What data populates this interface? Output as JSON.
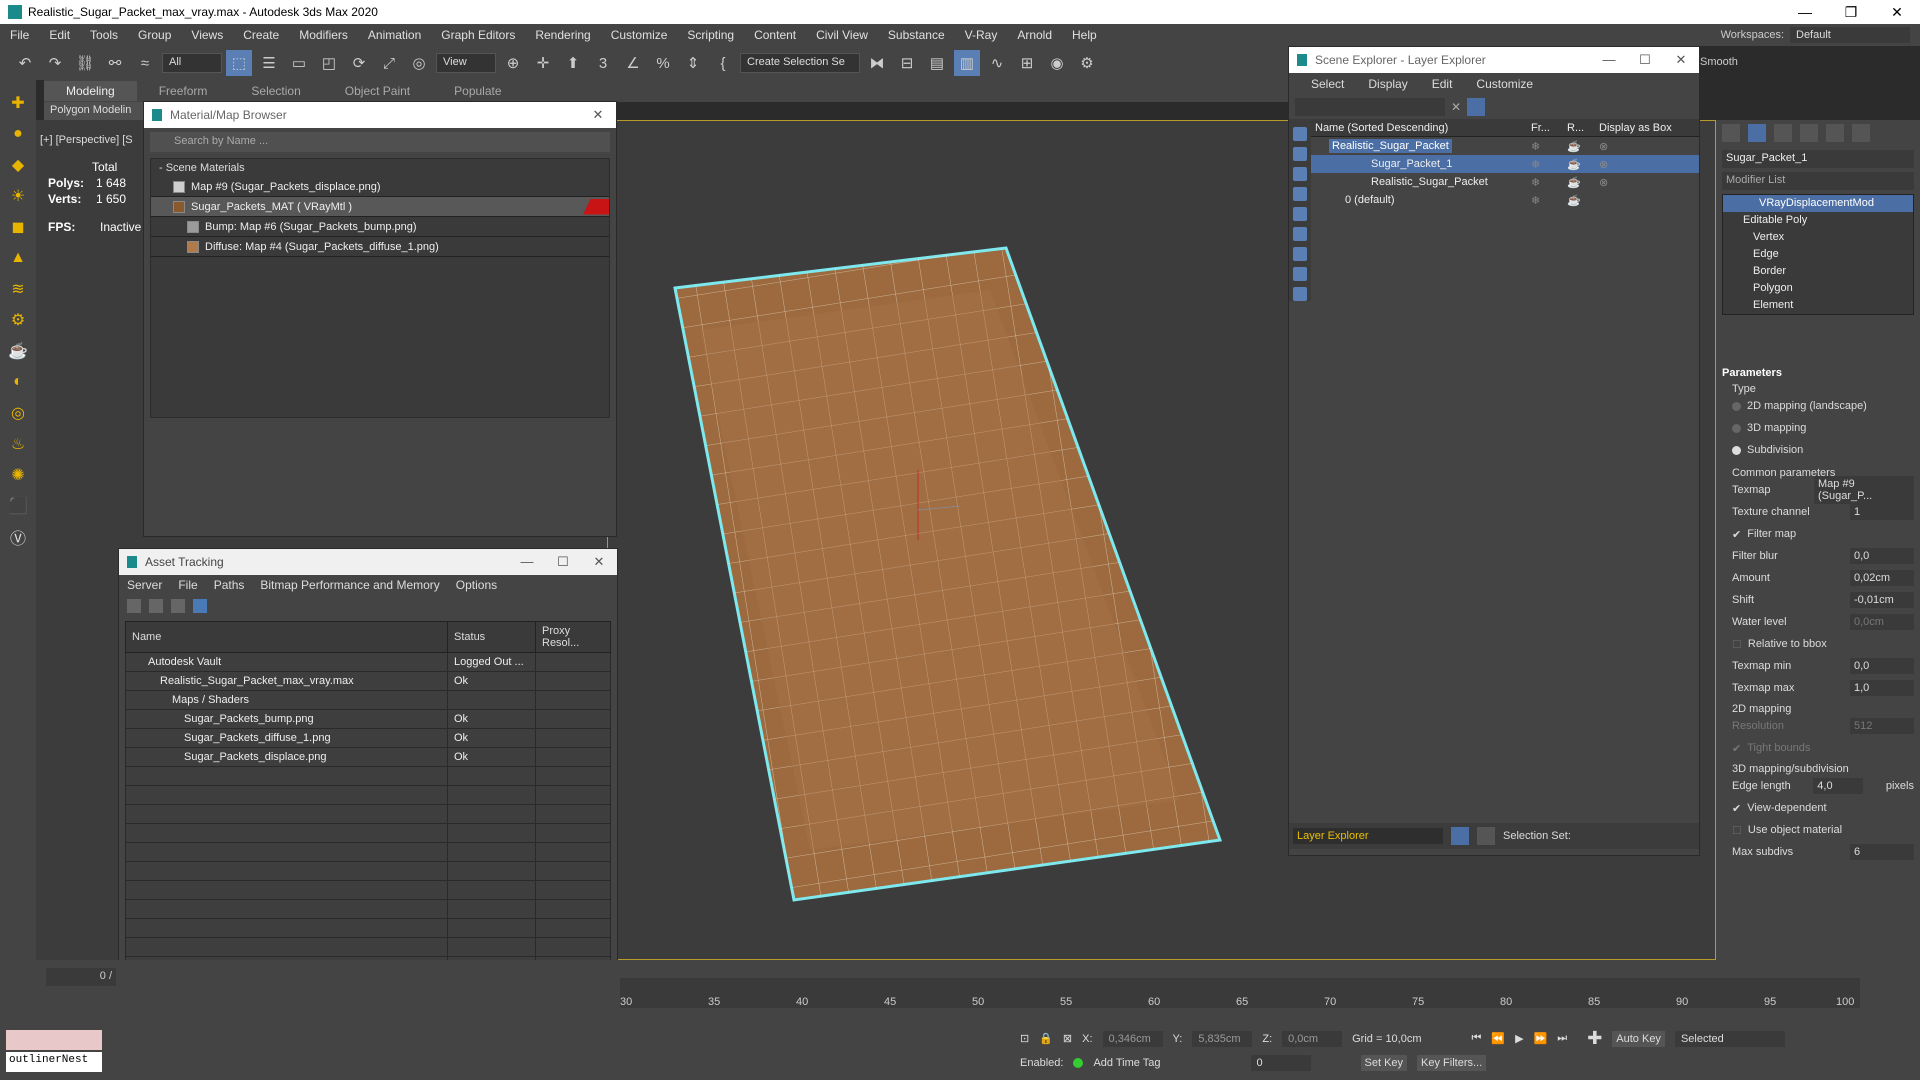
{
  "window": {
    "title": "Realistic_Sugar_Packet_max_vray.max - Autodesk 3ds Max 2020"
  },
  "menu": [
    "File",
    "Edit",
    "Tools",
    "Group",
    "Views",
    "Create",
    "Modifiers",
    "Animation",
    "Graph Editors",
    "Rendering",
    "Customize",
    "Scripting",
    "Content",
    "Civil View",
    "Substance",
    "V-Ray",
    "Arnold",
    "Help"
  ],
  "workspace": {
    "label": "Workspaces:",
    "value": "Default"
  },
  "toolbar": {
    "filter_value": "All",
    "view_value": "View",
    "selection_set": "Create Selection Se",
    "smooth_label": "Smooth"
  },
  "ribbon": {
    "tabs": [
      "Modeling",
      "Freeform",
      "Selection",
      "Object Paint",
      "Populate"
    ],
    "sub": "Polygon Modelin"
  },
  "viewport": {
    "label": "[+] [Perspective] [S",
    "stats": {
      "total": "Total",
      "polys_label": "Polys:",
      "polys": "1 648",
      "verts_label": "Verts:",
      "verts": "1 650",
      "fps_label": "FPS:",
      "fps": "Inactive"
    }
  },
  "material_browser": {
    "title": "Material/Map Browser",
    "search_placeholder": "Search by Name ...",
    "section": "- Scene Materials",
    "rows": [
      {
        "label": "Map #9 (Sugar_Packets_displace.png)",
        "color": "#cfcfcf"
      },
      {
        "label": "Sugar_Packets_MAT  ( VRayMtl )",
        "color": "#8a5a2e"
      },
      {
        "label": "Bump: Map #6 (Sugar_Packets_bump.png)",
        "color": "#9a9a9a"
      },
      {
        "label": "Diffuse: Map #4 (Sugar_Packets_diffuse_1.png)",
        "color": "#b07a4a"
      }
    ]
  },
  "asset_tracking": {
    "title": "Asset Tracking",
    "menu": [
      "Server",
      "File",
      "Paths",
      "Bitmap Performance and Memory",
      "Options"
    ],
    "columns": [
      "Name",
      "Status",
      "Proxy Resol..."
    ],
    "rows": [
      {
        "name": "Autodesk Vault",
        "status": "Logged Out ...",
        "proxy": ""
      },
      {
        "name": "Realistic_Sugar_Packet_max_vray.max",
        "status": "Ok",
        "proxy": ""
      },
      {
        "name": "Maps / Shaders",
        "status": "",
        "proxy": ""
      },
      {
        "name": "Sugar_Packets_bump.png",
        "status": "Ok",
        "proxy": ""
      },
      {
        "name": "Sugar_Packets_diffuse_1.png",
        "status": "Ok",
        "proxy": ""
      },
      {
        "name": "Sugar_Packets_displace.png",
        "status": "Ok",
        "proxy": ""
      }
    ]
  },
  "scene_explorer": {
    "title": "Scene Explorer - Layer Explorer",
    "menu": [
      "Select",
      "Display",
      "Edit",
      "Customize"
    ],
    "columns": [
      "Name (Sorted Descending)",
      "Fr...",
      "R...",
      "Display as Box"
    ],
    "rows": [
      {
        "name": "Realistic_Sugar_Packet"
      },
      {
        "name": "Sugar_Packet_1"
      },
      {
        "name": "Realistic_Sugar_Packet"
      },
      {
        "name": "0 (default)"
      }
    ],
    "footer_layer": "Layer Explorer",
    "footer_selset": "Selection Set:"
  },
  "command_panel": {
    "object_name": "Sugar_Packet_1",
    "modifier_list": "Modifier List",
    "stack": [
      "VRayDisplacementMod",
      "Editable Poly",
      "Vertex",
      "Edge",
      "Border",
      "Polygon",
      "Element"
    ],
    "params_title": "Parameters",
    "type_label": "Type",
    "type_options": [
      "2D mapping (landscape)",
      "3D mapping",
      "Subdivision"
    ],
    "common_label": "Common parameters",
    "fields": [
      {
        "label": "Texmap",
        "value": "Map #9 (Sugar_P..."
      },
      {
        "label": "Texture channel",
        "value": "1"
      },
      {
        "label": "Filter map",
        "value": ""
      },
      {
        "label": "Filter blur",
        "value": "0,0"
      },
      {
        "label": "Amount",
        "value": "0,02cm"
      },
      {
        "label": "Shift",
        "value": "-0,01cm"
      },
      {
        "label": "Water level",
        "value": "0,0cm"
      },
      {
        "label": "Relative to bbox",
        "value": ""
      },
      {
        "label": "Texmap min",
        "value": "0,0"
      },
      {
        "label": "Texmap max",
        "value": "1,0"
      }
    ],
    "mapping2d": "2D mapping",
    "resolution": {
      "label": "Resolution",
      "value": "512"
    },
    "tight": "Tight bounds",
    "subdiv": "3D mapping/subdivision",
    "edge_length": {
      "label": "Edge length",
      "value": "4,0",
      "unit": "pixels"
    },
    "view_dependent": "View-dependent",
    "use_obj_mat": "Use object material",
    "max_subdivs": {
      "label": "Max subdivs",
      "value": "6"
    }
  },
  "timeline": {
    "frame": "0 /",
    "ticks": [
      "30",
      "35",
      "40",
      "45",
      "50",
      "55",
      "60",
      "65",
      "70",
      "75",
      "80",
      "85",
      "90",
      "95",
      "100"
    ]
  },
  "status": {
    "x_label": "X:",
    "x": "0,346cm",
    "y_label": "Y:",
    "y": "5,835cm",
    "z_label": "Z:",
    "z": "0,0cm",
    "grid": "Grid = 10,0cm",
    "enabled": "Enabled:",
    "add_time_tag": "Add Time Tag",
    "auto_key": "Auto Key",
    "selected": "Selected",
    "set_key": "Set Key",
    "key_filters": "Key Filters...",
    "frame_val": "0"
  },
  "bottom_left": {
    "outliner": "outlinerNest"
  }
}
